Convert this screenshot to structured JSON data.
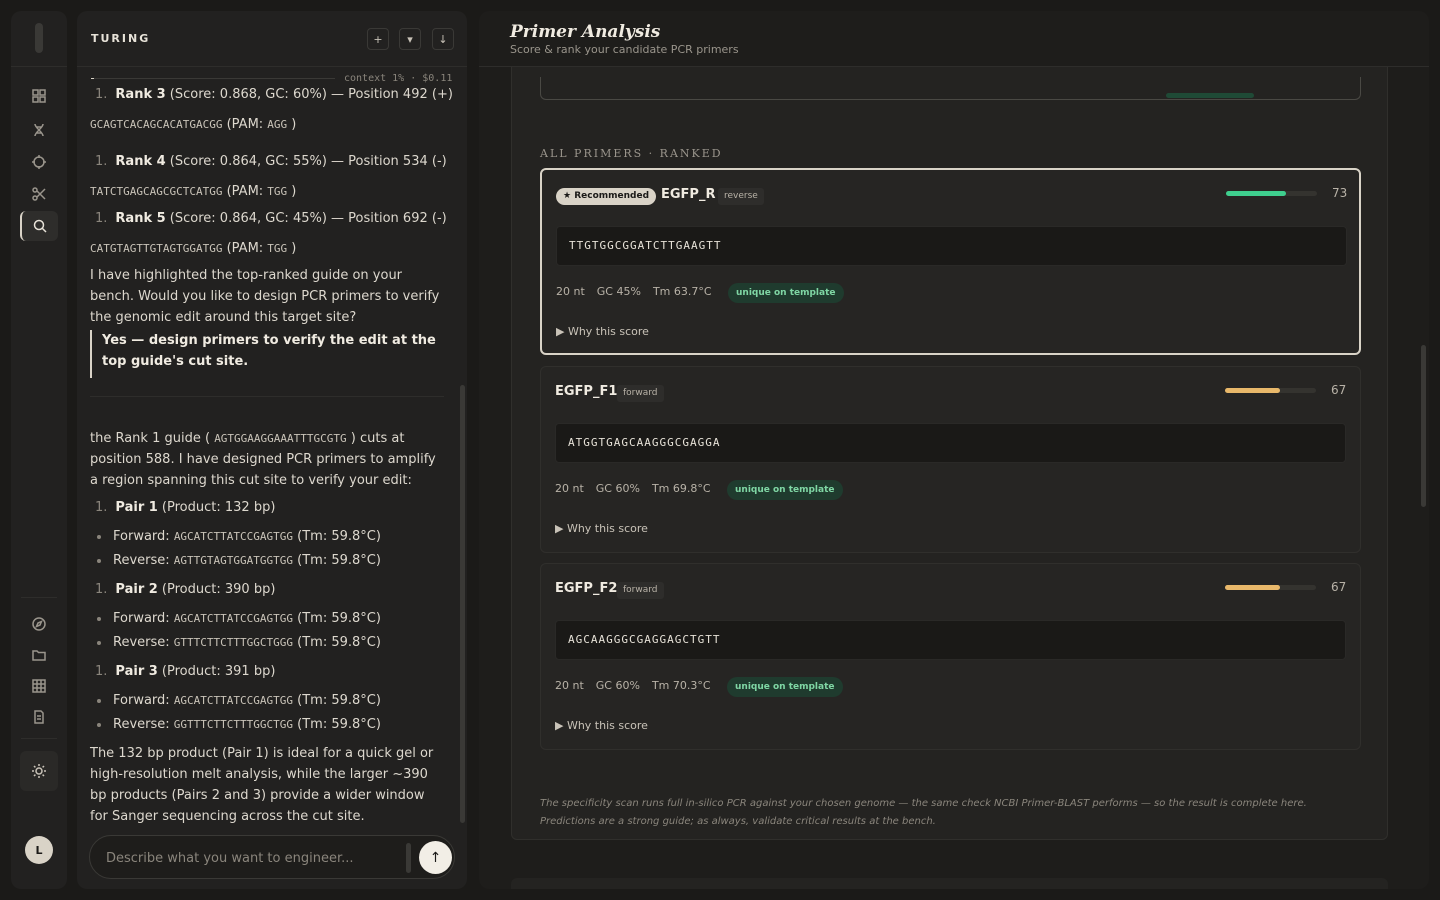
{
  "app": {
    "brand": "TURING",
    "avatar_initial": "L"
  },
  "rail": {
    "top_icons": [
      "grid-icon",
      "dna-icon",
      "target-icon",
      "scissors-icon",
      "search-icon"
    ],
    "bottom_icons": [
      "compass-icon",
      "folder-icon",
      "table-icon",
      "document-icon"
    ],
    "active": "search-icon"
  },
  "chat": {
    "header_buttons": [
      "+",
      "▾",
      "↓"
    ],
    "context_label": "context 1% · $0.11",
    "guides": [
      {
        "text": "Rank 3 (Score: 0.868, GC: 60%) — Position 492 (+)",
        "seq": "GCAGTCACAGCACATGACGG",
        "pam": "AGG"
      },
      {
        "text": "Rank 4 (Score: 0.864, GC: 55%) — Position 534 (-)",
        "seq": "TATCTGAGCAGCGCTCATGG",
        "pam": "TGG"
      },
      {
        "text": "Rank 5 (Score: 0.864, GC: 45%) — Position 692 (-)",
        "seq": "CATGTAGTTGTAGTGGATGG",
        "pam": "TGG"
      }
    ],
    "rank_prefix": [
      "Rank 3",
      "Rank 4",
      "Rank 5"
    ],
    "rank_rest": [
      " (Score: 0.868, GC: 60%) — Position 492 (+)",
      " (Score: 0.864, GC: 55%) — Position 534 (-)",
      " (Score: 0.864, GC: 45%) — Position 692 (-)"
    ],
    "pam_label": "(PAM: ",
    "pam_close": " )",
    "assistant_question": "I have highlighted the top-ranked guide on your bench. Would you like to design PCR primers to verify the genomic edit around this target site?",
    "user_reply": "Yes — design primers to verify the edit at the top guide's cut site.",
    "reply_intro_a": "the Rank 1 guide (",
    "reply_intro_seq": "AGTGGAAGGAAATTTGCGTG",
    "reply_intro_b": ") cuts at position 588. I have designed PCR primers to amplify a region spanning this cut site to verify your edit:",
    "pairs": [
      {
        "title": "Pair 1",
        "product": " (Product: 132 bp)",
        "fwd": "AGCATCTTATCCGAGTGG",
        "fwd_tm": "(Tm: 59.8°C)",
        "rev": "AGTTGTAGTGGATGGTGG",
        "rev_tm": "(Tm: 59.8°C)"
      },
      {
        "title": "Pair 2",
        "product": " (Product: 390 bp)",
        "fwd": "AGCATCTTATCCGAGTGG",
        "fwd_tm": "(Tm: 59.8°C)",
        "rev": "GTTTCTTCTTTGGCTGGG",
        "rev_tm": "(Tm: 59.8°C)"
      },
      {
        "title": "Pair 3",
        "product": " (Product: 391 bp)",
        "fwd": "AGCATCTTATCCGAGTGG",
        "fwd_tm": "(Tm: 59.8°C)",
        "rev": "GGTTTCTTCTTTGGCTGG",
        "rev_tm": "(Tm: 59.8°C)"
      }
    ],
    "forward_label": "Forward:",
    "reverse_label": "Reverse:",
    "list_number": "1.",
    "summary": "The 132 bp product (Pair 1) is ideal for a quick gel or high-resolution melt analysis, while the larger ~390 bp products (Pairs 2 and 3) provide a wider window for Sanger sequencing across the cut site.",
    "composer_placeholder": "Describe what you want to engineer..."
  },
  "main": {
    "title": "Primer Analysis",
    "subtitle": "Score & rank your candidate PCR primers",
    "section_label": "ALL PRIMERS · RANKED",
    "recommended_label": "★ Recommended",
    "primers": [
      {
        "name": "EGFP_R",
        "direction": "reverse",
        "score": 73,
        "seq": "TTGTGGCGGATCTTGAAGTT",
        "length": "20 nt",
        "gc": "GC 45%",
        "tm": "Tm 63.7°C",
        "specificity": "unique on template",
        "why": "▶ Why this score",
        "bar_color": "#3fcf8e"
      },
      {
        "name": "EGFP_F1",
        "direction": "forward",
        "score": 67,
        "seq": "ATGGTGAGCAAGGGCGAGGA",
        "length": "20 nt",
        "gc": "GC 60%",
        "tm": "Tm 69.8°C",
        "specificity": "unique on template",
        "why": "▶ Why this score",
        "bar_color": "#e8b86a"
      },
      {
        "name": "EGFP_F2",
        "direction": "forward",
        "score": 67,
        "seq": "AGCAAGGGCGAGGAGCTGTT",
        "length": "20 nt",
        "gc": "GC 60%",
        "tm": "Tm 70.3°C",
        "specificity": "unique on template",
        "why": "▶ Why this score",
        "bar_color": "#e8b86a"
      }
    ],
    "footnote": "The specificity scan runs full in-silico PCR against your chosen genome — the same check NCBI Primer-BLAST performs — so the result is complete here. Predictions are a strong guide; as always, validate critical results at the bench."
  }
}
